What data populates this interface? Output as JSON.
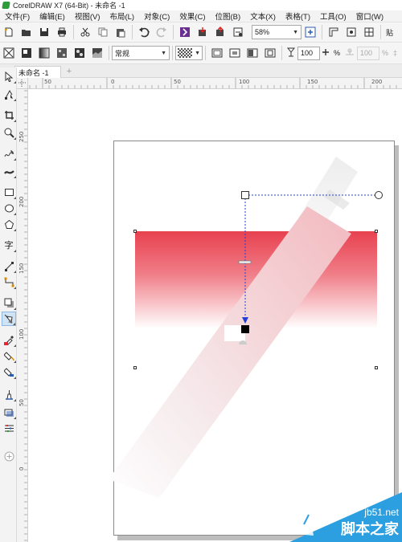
{
  "window": {
    "title": "CorelDRAW X7 (64-Bit) - 未命名 -1"
  },
  "menu": [
    "文件(F)",
    "编辑(E)",
    "视图(V)",
    "布局(L)",
    "对象(C)",
    "效果(C)",
    "位图(B)",
    "文本(X)",
    "表格(T)",
    "工具(O)",
    "窗口(W)"
  ],
  "toolbar": {
    "zoom_value": "58%",
    "last_button_label": "贴"
  },
  "property_bar": {
    "blend_mode": "常规",
    "transparency_value": "100",
    "transparency_unit": "%",
    "percent_symbol": "%",
    "secondary_value": "100",
    "secondary_unit": "%"
  },
  "tabs": {
    "document_tab": "未命名 -1",
    "add_tab_symbol": "+"
  },
  "rulers": {
    "h_labels": [
      "50",
      "0",
      "50",
      "100",
      "150",
      "200"
    ],
    "v_labels": [
      "250",
      "200",
      "150",
      "100",
      "50",
      "0"
    ]
  },
  "watermark": {
    "site": "jb51.net",
    "name": "脚本之家"
  },
  "colors": {
    "accent_red": "#e8414f",
    "selection_blue": "#1f3fd6",
    "watermark_blue": "#2c9fe0"
  }
}
